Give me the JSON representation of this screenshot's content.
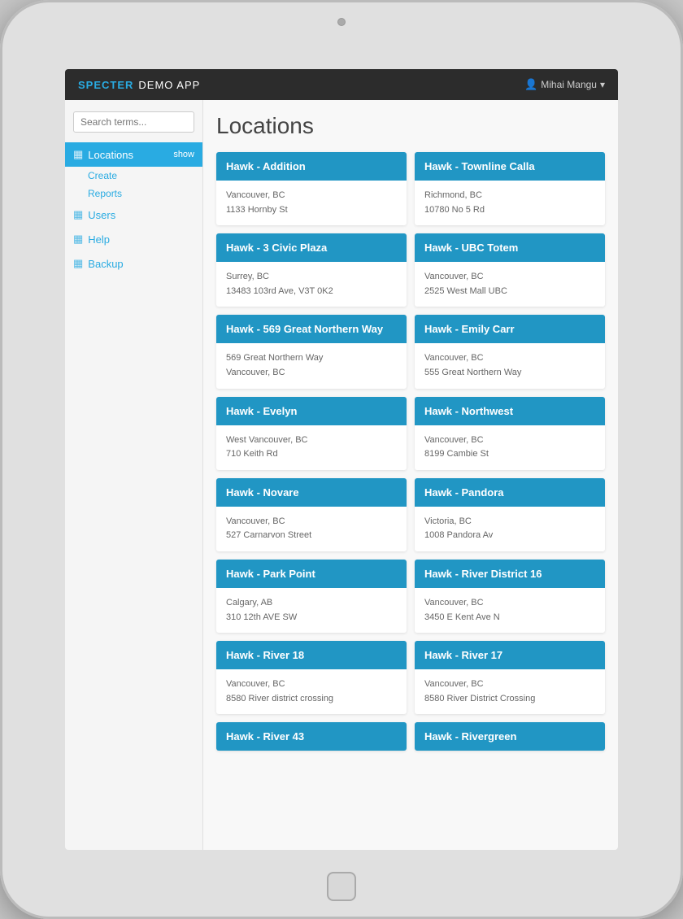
{
  "brand": {
    "specter": "SPECTER",
    "demo": "DEMO APP"
  },
  "user": {
    "name": "Mihai Mangu",
    "icon": "👤"
  },
  "search": {
    "placeholder": "Search terms..."
  },
  "sidebar": {
    "items": [
      {
        "id": "locations",
        "label": "Locations",
        "icon": "▦",
        "active": true,
        "badge": "show"
      },
      {
        "id": "create",
        "label": "Create",
        "icon": "",
        "active": false,
        "sub": true
      },
      {
        "id": "reports",
        "label": "Reports",
        "icon": "",
        "active": false,
        "sub": true
      },
      {
        "id": "users",
        "label": "Users",
        "icon": "▦",
        "active": false,
        "sub": false
      },
      {
        "id": "help",
        "label": "Help",
        "icon": "▦",
        "active": false,
        "sub": false
      },
      {
        "id": "backup",
        "label": "Backup",
        "icon": "▦",
        "active": false,
        "sub": false
      }
    ]
  },
  "page": {
    "title": "Locations"
  },
  "locations": [
    {
      "title": "Hawk - Addition",
      "city": "Vancouver, BC",
      "address": "1133 Hornby St"
    },
    {
      "title": "Hawk - Townline Calla",
      "city": "Richmond, BC",
      "address": "10780 No 5 Rd"
    },
    {
      "title": "Hawk - 3 Civic Plaza",
      "city": "Surrey, BC",
      "address": "13483 103rd Ave, V3T 0K2"
    },
    {
      "title": "Hawk - UBC Totem",
      "city": "Vancouver, BC",
      "address": "2525 West Mall UBC"
    },
    {
      "title": "Hawk - 569 Great Northern Way",
      "city": "569 Great Northern Way",
      "address": "Vancouver, BC"
    },
    {
      "title": "Hawk - Emily Carr",
      "city": "Vancouver, BC",
      "address": "555 Great Northern Way"
    },
    {
      "title": "Hawk - Evelyn",
      "city": "West Vancouver, BC",
      "address": "710 Keith Rd"
    },
    {
      "title": "Hawk - Northwest",
      "city": "Vancouver, BC",
      "address": "8199 Cambie St"
    },
    {
      "title": "Hawk - Novare",
      "city": "Vancouver, BC",
      "address": "527 Carnarvon Street"
    },
    {
      "title": "Hawk - Pandora",
      "city": "Victoria, BC",
      "address": "1008 Pandora Av"
    },
    {
      "title": "Hawk - Park Point",
      "city": "Calgary, AB",
      "address": "310 12th AVE SW"
    },
    {
      "title": "Hawk - River District 16",
      "city": "Vancouver, BC",
      "address": "3450 E Kent Ave N"
    },
    {
      "title": "Hawk - River 18",
      "city": "Vancouver, BC",
      "address": "8580 River district crossing"
    },
    {
      "title": "Hawk - River 17",
      "city": "Vancouver, BC",
      "address": "8580 River District Crossing"
    },
    {
      "title": "Hawk - River 43",
      "city": "",
      "address": ""
    },
    {
      "title": "Hawk - Rivergreen",
      "city": "",
      "address": ""
    }
  ]
}
